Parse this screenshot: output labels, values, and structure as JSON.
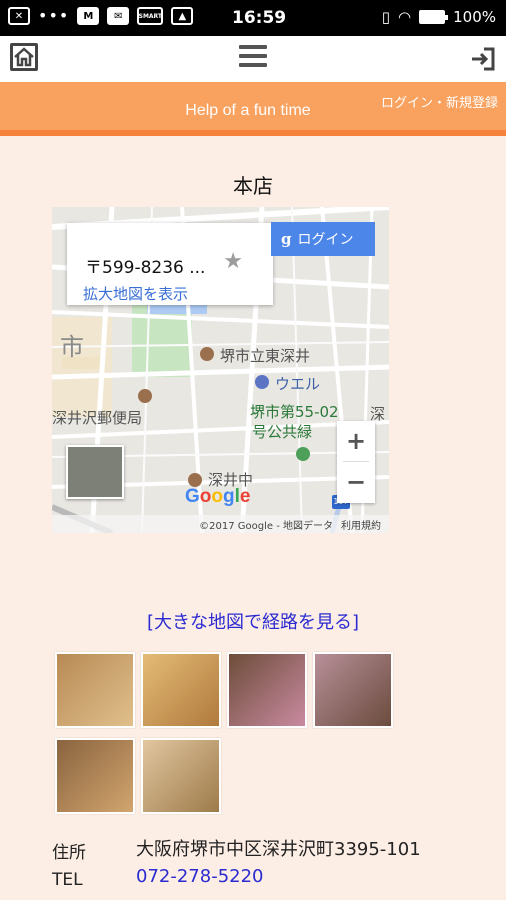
{
  "status_bar": {
    "time": "16:59",
    "battery": "100%",
    "notif_icons": [
      "x-box-icon",
      "gmail-icon",
      "mail-icon",
      "news-icon",
      "image-icon"
    ],
    "news_icon_text": "SMART"
  },
  "nav": {
    "home_icon": "home-icon",
    "menu_icon": "hamburger-menu-icon",
    "login_icon": "sign-in-icon"
  },
  "banner": {
    "tagline": "Help of a fun time",
    "login_link": "ログイン・新規登録"
  },
  "store": {
    "title": "本店"
  },
  "map": {
    "card_address": "〒599-8236 ...",
    "card_link": "拡大地図を表示",
    "google_login": "ログイン",
    "labels": {
      "city": "市",
      "shrine": "堺市立東深井",
      "shop": "ウエル",
      "post_office": "深井沢郵便局",
      "park_line1": "堺市第55-02",
      "park_line2": "号公共緑",
      "school": "深井中",
      "fuka": "深",
      "edge_kanji": "深",
      "route_number": "197"
    },
    "zoom_in": "+",
    "zoom_out": "−",
    "logo": "Google",
    "copyright": "©2017 Google - 地図データ",
    "terms": "利用規約"
  },
  "route_link": "[大きな地図で経路を見る]",
  "photos": [
    {
      "desc": "photo-1",
      "color": "#c9a06a"
    },
    {
      "desc": "photo-2",
      "color": "#d8a560"
    },
    {
      "desc": "photo-3",
      "color": "#7a5a44"
    },
    {
      "desc": "photo-4",
      "color": "#8e6e62"
    },
    {
      "desc": "photo-5",
      "color": "#a8835a"
    },
    {
      "desc": "photo-6",
      "color": "#c49d6e"
    }
  ],
  "info": {
    "address_label": "住所",
    "address_value": "大阪府堺市中区深井沢町3395-101",
    "tel_label": "TEL",
    "tel_value": "072-278-5220"
  },
  "colors": {
    "banner": "#f9a15e",
    "background": "#fdeee5",
    "link": "#2b2bd1"
  }
}
